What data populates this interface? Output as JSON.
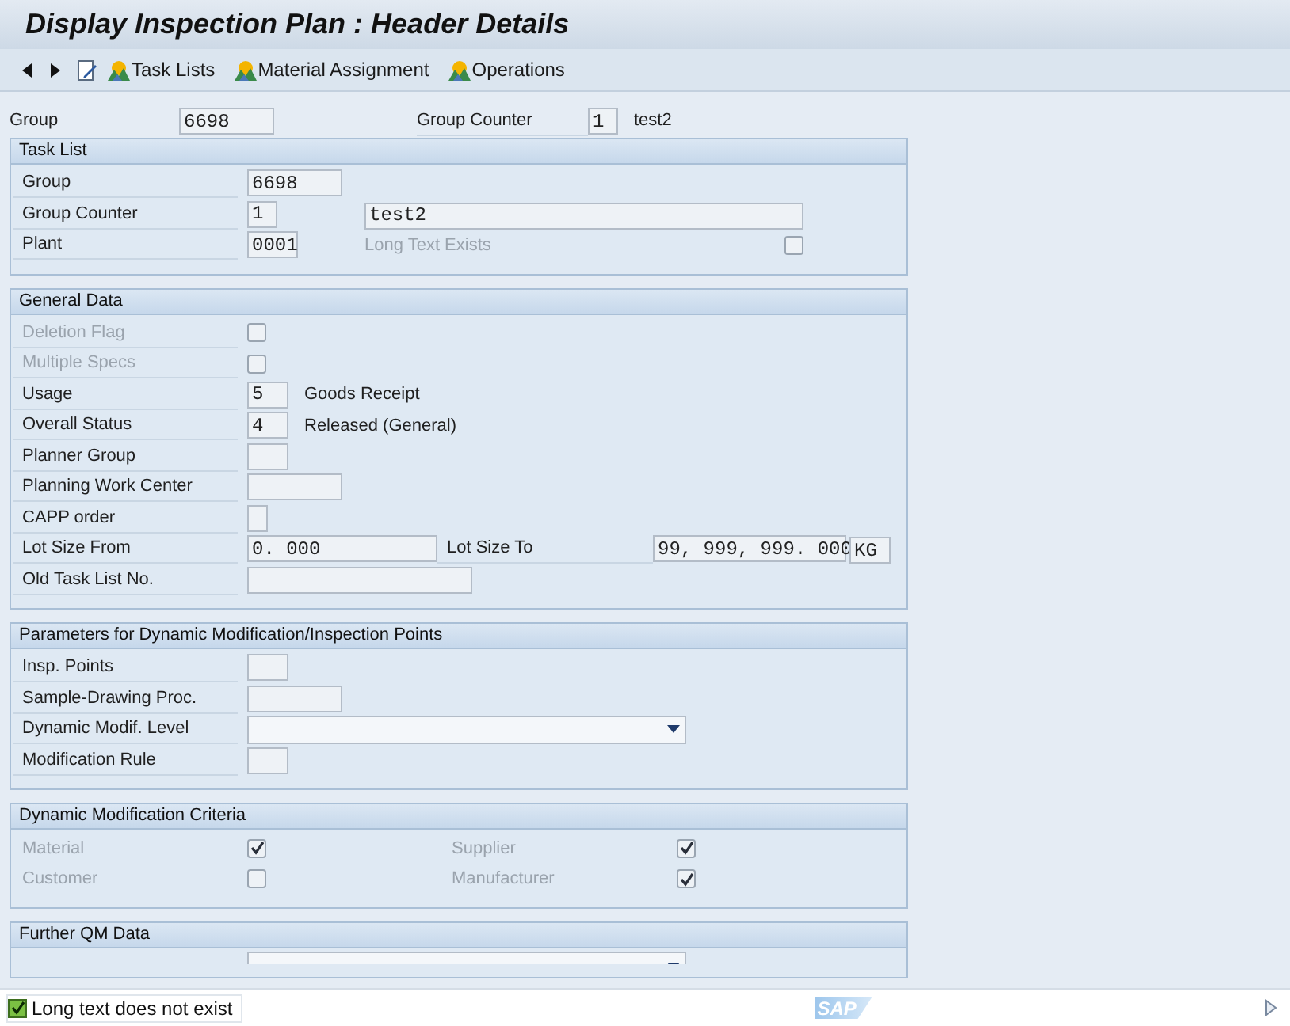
{
  "window": {
    "title": "Display Inspection Plan : Header Details"
  },
  "toolbar": [
    {
      "kind": "back"
    },
    {
      "kind": "forward"
    },
    {
      "kind": "edit"
    },
    {
      "kind": "button",
      "label": "Task Lists"
    },
    {
      "kind": "button",
      "label": "Material Assignment"
    },
    {
      "kind": "button",
      "label": "Operations"
    }
  ],
  "header": {
    "group_label": "Group",
    "group_value": "6698",
    "counter_label": "Group Counter",
    "counter_value": "1",
    "counter_text": "test2"
  },
  "sections": [
    {
      "title": "Task List",
      "rows": [
        {
          "kind": "field",
          "label": "Group",
          "disabled": false,
          "value": "6698"
        },
        {
          "kind": "field",
          "label": "Group Counter",
          "disabled": false,
          "value": "1",
          "extra_field": "test2"
        },
        {
          "kind": "field",
          "label": "Plant",
          "disabled": false,
          "value": "0001",
          "side_label": "Long Text Exists",
          "side_checked": false
        }
      ]
    },
    {
      "title": "General Data",
      "rows": [
        {
          "kind": "checkbox",
          "label": "Deletion Flag",
          "disabled": true,
          "checked": false
        },
        {
          "kind": "checkbox",
          "label": "Multiple Specs",
          "disabled": true,
          "checked": false
        },
        {
          "kind": "field",
          "label": "Usage",
          "disabled": false,
          "value": "5",
          "description": "Goods Receipt"
        },
        {
          "kind": "field",
          "label": "Overall Status",
          "disabled": false,
          "value": "4",
          "description": "Released (General)"
        },
        {
          "kind": "field",
          "label": "Planner Group",
          "disabled": false
        },
        {
          "kind": "field",
          "label": "Planning Work Center",
          "disabled": false
        },
        {
          "kind": "field",
          "label": "CAPP order",
          "disabled": false
        },
        {
          "kind": "range",
          "label": "Lot Size From",
          "disabled": false,
          "value": "0. 000",
          "to_label": "Lot Size To",
          "to_value": "99, 999, 999. 000",
          "unit": "KG"
        },
        {
          "kind": "field",
          "label": "Old Task List No.",
          "disabled": false
        }
      ]
    },
    {
      "title": "Parameters for Dynamic Modification/Inspection Points",
      "rows": [
        {
          "kind": "field",
          "label": "Insp. Points",
          "disabled": false
        },
        {
          "kind": "field",
          "label": "Sample-Drawing Proc.",
          "disabled": false
        },
        {
          "kind": "dropdown",
          "label": "Dynamic Modif. Level",
          "disabled": false
        },
        {
          "kind": "field",
          "label": "Modification Rule",
          "disabled": false
        }
      ]
    },
    {
      "title": "Dynamic Modification Criteria",
      "rows": [
        {
          "kind": "pair",
          "items": [
            {
              "label": "Material",
              "disabled": true,
              "checked": true
            },
            {
              "label": "Supplier",
              "disabled": true,
              "checked": true
            }
          ]
        },
        {
          "kind": "pair",
          "items": [
            {
              "label": "Customer",
              "disabled": true,
              "checked": false
            },
            {
              "label": "Manufacturer",
              "disabled": true,
              "checked": true
            }
          ]
        }
      ]
    },
    {
      "title": "Further QM Data",
      "rows": [
        {
          "kind": "dropdown_cut"
        }
      ]
    }
  ],
  "status_bar": {
    "message": "Long text does not exist",
    "ok": true,
    "logo": "SAP"
  }
}
